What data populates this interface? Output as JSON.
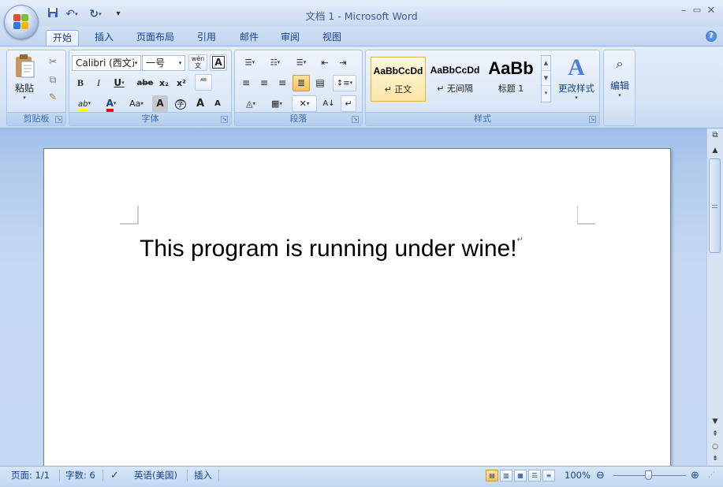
{
  "window": {
    "title": "文档 1 - Microsoft Word",
    "minimize": "–",
    "restore": "▭",
    "close": "✕"
  },
  "qat": {
    "save_icon": "floppy-disk-icon",
    "undo": "↶",
    "redo": "↻",
    "customize": "▾"
  },
  "tabs": [
    "开始",
    "插入",
    "页面布局",
    "引用",
    "邮件",
    "审阅",
    "视图"
  ],
  "help": "?",
  "ribbon": {
    "clipboard": {
      "paste": "粘贴",
      "label": "剪贴板"
    },
    "font": {
      "font_name": "Calibri (西文正",
      "font_size": "一号",
      "phonetic": "wén\n文",
      "char_border": "A",
      "bold": "B",
      "italic": "I",
      "underline": "U",
      "strike": "abe",
      "subscript": "x₂",
      "superscript": "x²",
      "clear": "ᴬᴮ",
      "highlight": "ab",
      "font_color": "A",
      "change_case": "Aa",
      "char_shading": "A",
      "enclose": "字",
      "grow": "A",
      "shrink": "A",
      "label": "字体"
    },
    "paragraph": {
      "label": "段落"
    },
    "styles": {
      "items": [
        {
          "preview": "AaBbCcDd",
          "name": "↵ 正文"
        },
        {
          "preview": "AaBbCcDd",
          "name": "↵ 无间隔"
        },
        {
          "preview": "AaBb",
          "name": "标题 1"
        }
      ],
      "change_styles": "更改样式",
      "label": "样式"
    },
    "editing": {
      "label": "编辑"
    }
  },
  "document": {
    "text": "This program is running under wine!",
    "para_mark": "↵"
  },
  "status": {
    "page": "页面: 1/1",
    "words": "字数: 6",
    "language": "英语(美国)",
    "mode": "插入",
    "zoom": "100%"
  },
  "colors": {
    "accent": "#15428b",
    "ribbon_bg": "#d4e3f6",
    "highlight_yellow": "#ffff00",
    "font_red": "#ff0000"
  }
}
